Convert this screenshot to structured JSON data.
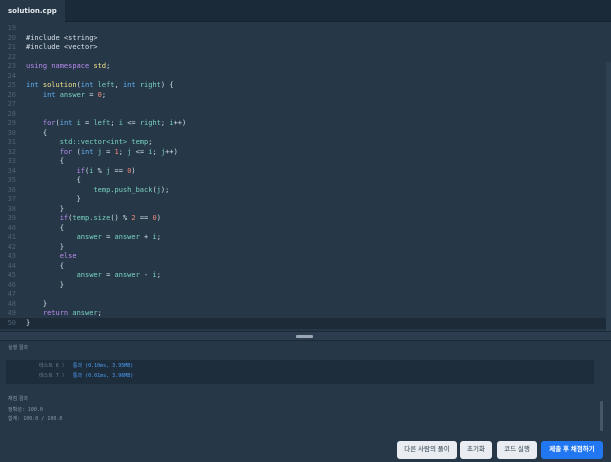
{
  "file_tab": {
    "label": "solution.cpp"
  },
  "editor": {
    "lines": [
      {
        "n": "19",
        "t": []
      },
      {
        "n": "20",
        "t": [
          [
            "pl",
            "#include <string>"
          ]
        ]
      },
      {
        "n": "21",
        "t": [
          [
            "pl",
            "#include <vector>"
          ]
        ]
      },
      {
        "n": "22",
        "t": []
      },
      {
        "n": "23",
        "t": [
          [
            "kw",
            "using namespace "
          ],
          [
            "fn",
            "std"
          ],
          [
            "pl",
            ";"
          ]
        ]
      },
      {
        "n": "24",
        "t": []
      },
      {
        "n": "25",
        "t": [
          [
            "ty",
            "int "
          ],
          [
            "fn",
            "solution"
          ],
          [
            "pl",
            "("
          ],
          [
            "ty",
            "int "
          ],
          [
            "id",
            "left"
          ],
          [
            "pl",
            ", "
          ],
          [
            "ty",
            "int "
          ],
          [
            "id",
            "right"
          ],
          [
            "pl",
            ") {"
          ]
        ]
      },
      {
        "n": "26",
        "t": [
          [
            "pl",
            "    "
          ],
          [
            "ty",
            "int "
          ],
          [
            "id",
            "answer"
          ],
          [
            "pl",
            " = "
          ],
          [
            "nm",
            "0"
          ],
          [
            "pl",
            ";"
          ]
        ]
      },
      {
        "n": "27",
        "t": []
      },
      {
        "n": "28",
        "t": []
      },
      {
        "n": "29",
        "t": [
          [
            "pl",
            "    "
          ],
          [
            "kw",
            "for"
          ],
          [
            "pl",
            "("
          ],
          [
            "ty",
            "int "
          ],
          [
            "id",
            "i"
          ],
          [
            "pl",
            " = "
          ],
          [
            "id",
            "left"
          ],
          [
            "pl",
            "; "
          ],
          [
            "id",
            "i"
          ],
          [
            "pl",
            " <= "
          ],
          [
            "id",
            "right"
          ],
          [
            "pl",
            "; "
          ],
          [
            "id",
            "i"
          ],
          [
            "pl",
            "++)"
          ]
        ]
      },
      {
        "n": "30",
        "t": [
          [
            "pl",
            "    {"
          ]
        ]
      },
      {
        "n": "31",
        "t": [
          [
            "pl",
            "        "
          ],
          [
            "id",
            "std::vector<int> temp"
          ],
          [
            "pl",
            ";"
          ]
        ]
      },
      {
        "n": "32",
        "t": [
          [
            "pl",
            "        "
          ],
          [
            "kw",
            "for"
          ],
          [
            "pl",
            " ("
          ],
          [
            "ty",
            "int "
          ],
          [
            "id",
            "j"
          ],
          [
            "pl",
            " = "
          ],
          [
            "nm",
            "1"
          ],
          [
            "pl",
            "; "
          ],
          [
            "id",
            "j"
          ],
          [
            "pl",
            " <= "
          ],
          [
            "id",
            "i"
          ],
          [
            "pl",
            "; "
          ],
          [
            "id",
            "j"
          ],
          [
            "pl",
            "++)"
          ]
        ]
      },
      {
        "n": "33",
        "t": [
          [
            "pl",
            "        {"
          ]
        ]
      },
      {
        "n": "34",
        "t": [
          [
            "pl",
            "            "
          ],
          [
            "kw",
            "if"
          ],
          [
            "pl",
            "("
          ],
          [
            "id",
            "i"
          ],
          [
            "pl",
            " % "
          ],
          [
            "id",
            "j"
          ],
          [
            "pl",
            " == "
          ],
          [
            "nm",
            "0"
          ],
          [
            "pl",
            ")"
          ]
        ]
      },
      {
        "n": "35",
        "t": [
          [
            "pl",
            "            {"
          ]
        ]
      },
      {
        "n": "36",
        "t": [
          [
            "pl",
            "                "
          ],
          [
            "id",
            "temp.push_back"
          ],
          [
            "pl",
            "("
          ],
          [
            "id",
            "j"
          ],
          [
            "pl",
            ");"
          ]
        ]
      },
      {
        "n": "37",
        "t": [
          [
            "pl",
            "            }"
          ]
        ]
      },
      {
        "n": "38",
        "t": [
          [
            "pl",
            "        }"
          ]
        ]
      },
      {
        "n": "39",
        "t": [
          [
            "pl",
            "        "
          ],
          [
            "kw",
            "if"
          ],
          [
            "pl",
            "("
          ],
          [
            "id",
            "temp.size"
          ],
          [
            "pl",
            "() % "
          ],
          [
            "nm",
            "2"
          ],
          [
            "pl",
            " == "
          ],
          [
            "nm",
            "0"
          ],
          [
            "pl",
            ")"
          ]
        ]
      },
      {
        "n": "40",
        "t": [
          [
            "pl",
            "        {"
          ]
        ]
      },
      {
        "n": "41",
        "t": [
          [
            "pl",
            "            "
          ],
          [
            "id",
            "answer"
          ],
          [
            "pl",
            " = "
          ],
          [
            "id",
            "answer"
          ],
          [
            "pl",
            " + "
          ],
          [
            "id",
            "i"
          ],
          [
            "pl",
            ";"
          ]
        ]
      },
      {
        "n": "42",
        "t": [
          [
            "pl",
            "        }"
          ]
        ]
      },
      {
        "n": "43",
        "t": [
          [
            "pl",
            "        "
          ],
          [
            "kw",
            "else"
          ]
        ]
      },
      {
        "n": "44",
        "t": [
          [
            "pl",
            "        {"
          ]
        ]
      },
      {
        "n": "45",
        "t": [
          [
            "pl",
            "            "
          ],
          [
            "id",
            "answer"
          ],
          [
            "pl",
            " = "
          ],
          [
            "id",
            "answer"
          ],
          [
            "pl",
            " - "
          ],
          [
            "id",
            "i"
          ],
          [
            "pl",
            ";"
          ]
        ]
      },
      {
        "n": "46",
        "t": [
          [
            "pl",
            "        }"
          ]
        ]
      },
      {
        "n": "47",
        "t": []
      },
      {
        "n": "48",
        "t": [
          [
            "pl",
            "    }"
          ]
        ]
      },
      {
        "n": "49",
        "t": [
          [
            "pl",
            "    "
          ],
          [
            "kw",
            "return "
          ],
          [
            "id",
            "answer"
          ],
          [
            "pl",
            ";"
          ]
        ]
      },
      {
        "n": "50",
        "t": [
          [
            "pl",
            "}"
          ]
        ]
      }
    ]
  },
  "results": {
    "title": "실행 결과",
    "rows": [
      {
        "label": "테스트 6 〉",
        "value": "통과 (0.10ms, 3.95MB)"
      },
      {
        "label": "테스트 7 〉",
        "value": "통과 (0.01ms, 3.96MB)"
      }
    ],
    "score_title": "채점 결과",
    "accuracy": "정확성: 100.0",
    "total": "합계: 100.0 / 100.0"
  },
  "buttons": {
    "others": "다른 사람의 풀이",
    "reset": "초기화",
    "run": "코드 실행",
    "submit": "제출 후 채점하기"
  },
  "colors": {
    "editor_bg": "#263747",
    "keyword": "#b98cf0",
    "type": "#63b3f6",
    "function": "#f4e38a",
    "number": "#ef8a7a",
    "identifier": "#79d2c0",
    "pass": "#4d9df5",
    "primary_button": "#2176f1"
  }
}
